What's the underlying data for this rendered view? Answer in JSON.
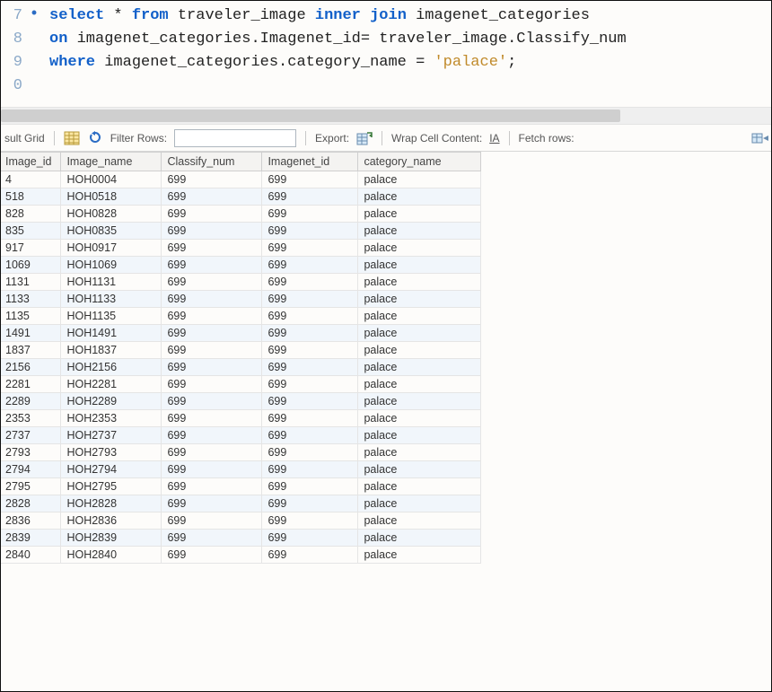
{
  "editor": {
    "lines": [
      {
        "num": "7",
        "exec": true,
        "tokens": [
          {
            "t": "select",
            "c": "kw"
          },
          {
            "t": " * "
          },
          {
            "t": "from",
            "c": "kw"
          },
          {
            "t": " traveler_image "
          },
          {
            "t": "inner join",
            "c": "kw"
          },
          {
            "t": " imagenet_categories"
          }
        ]
      },
      {
        "num": "8",
        "exec": false,
        "tokens": [
          {
            "t": "on",
            "c": "kw"
          },
          {
            "t": " imagenet_categories.Imagenet_id= traveler_image.Classify_num"
          }
        ]
      },
      {
        "num": "9",
        "exec": false,
        "tokens": [
          {
            "t": "where",
            "c": "kw"
          },
          {
            "t": " imagenet_categories.category_name = "
          },
          {
            "t": "'palace'",
            "c": "str"
          },
          {
            "t": ";"
          }
        ]
      },
      {
        "num": "0",
        "exec": false,
        "tokens": []
      }
    ]
  },
  "toolbar": {
    "result_grid_label": "sult Grid",
    "filter_rows_label": "Filter Rows:",
    "filter_value": "",
    "export_label": "Export:",
    "wrap_label": "Wrap Cell Content:",
    "wrap_value": "IA",
    "fetch_label": "Fetch rows:"
  },
  "grid": {
    "columns": [
      "Image_id",
      "Image_name",
      "Classify_num",
      "Imagenet_id",
      "category_name"
    ],
    "rows": [
      [
        "4",
        "HOH0004",
        "699",
        "699",
        "palace"
      ],
      [
        "518",
        "HOH0518",
        "699",
        "699",
        "palace"
      ],
      [
        "828",
        "HOH0828",
        "699",
        "699",
        "palace"
      ],
      [
        "835",
        "HOH0835",
        "699",
        "699",
        "palace"
      ],
      [
        "917",
        "HOH0917",
        "699",
        "699",
        "palace"
      ],
      [
        "1069",
        "HOH1069",
        "699",
        "699",
        "palace"
      ],
      [
        "1131",
        "HOH1131",
        "699",
        "699",
        "palace"
      ],
      [
        "1133",
        "HOH1133",
        "699",
        "699",
        "palace"
      ],
      [
        "1135",
        "HOH1135",
        "699",
        "699",
        "palace"
      ],
      [
        "1491",
        "HOH1491",
        "699",
        "699",
        "palace"
      ],
      [
        "1837",
        "HOH1837",
        "699",
        "699",
        "palace"
      ],
      [
        "2156",
        "HOH2156",
        "699",
        "699",
        "palace"
      ],
      [
        "2281",
        "HOH2281",
        "699",
        "699",
        "palace"
      ],
      [
        "2289",
        "HOH2289",
        "699",
        "699",
        "palace"
      ],
      [
        "2353",
        "HOH2353",
        "699",
        "699",
        "palace"
      ],
      [
        "2737",
        "HOH2737",
        "699",
        "699",
        "palace"
      ],
      [
        "2793",
        "HOH2793",
        "699",
        "699",
        "palace"
      ],
      [
        "2794",
        "HOH2794",
        "699",
        "699",
        "palace"
      ],
      [
        "2795",
        "HOH2795",
        "699",
        "699",
        "palace"
      ],
      [
        "2828",
        "HOH2828",
        "699",
        "699",
        "palace"
      ],
      [
        "2836",
        "HOH2836",
        "699",
        "699",
        "palace"
      ],
      [
        "2839",
        "HOH2839",
        "699",
        "699",
        "palace"
      ],
      [
        "2840",
        "HOH2840",
        "699",
        "699",
        "palace"
      ]
    ]
  }
}
